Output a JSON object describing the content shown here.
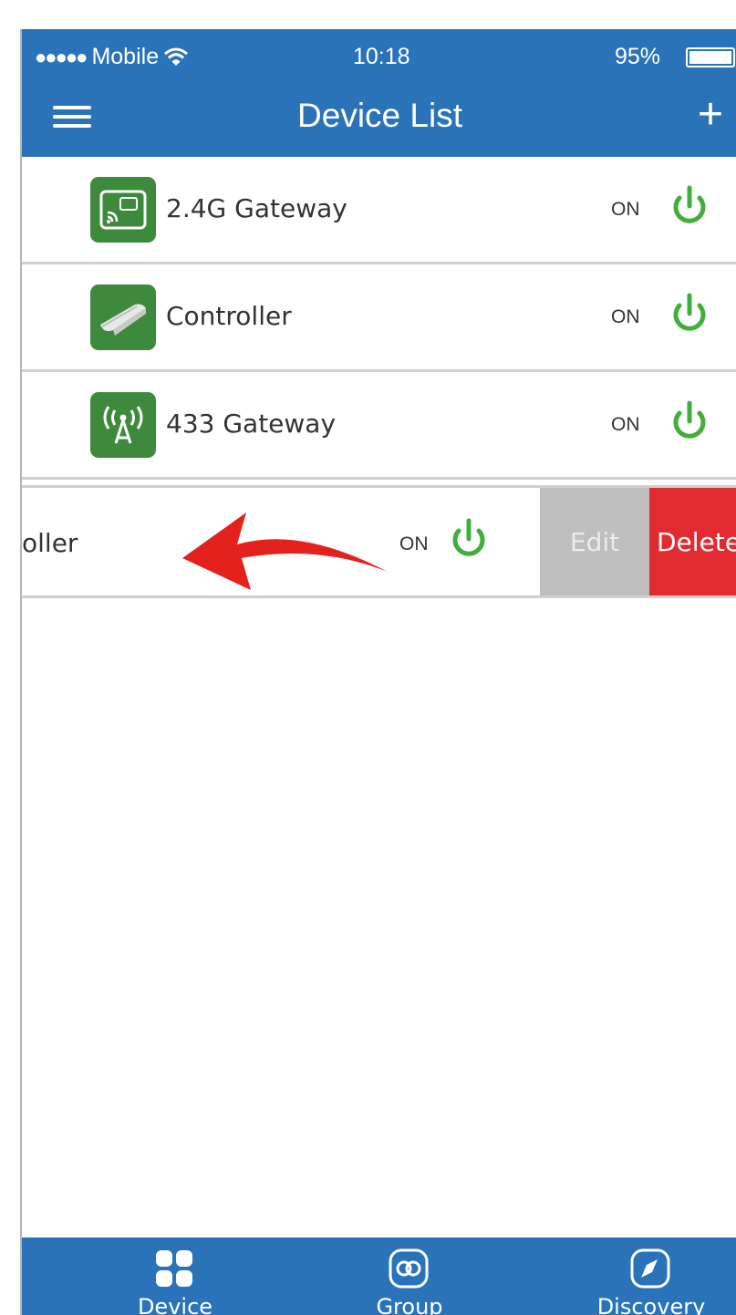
{
  "status_bar": {
    "carrier": "Mobile",
    "time": "10:18",
    "battery": "95%"
  },
  "header": {
    "title": "Device List",
    "add_label": "+"
  },
  "devices": [
    {
      "name": "2.4G Gateway",
      "state": "ON",
      "icon": "gateway-24g-icon"
    },
    {
      "name": "Controller",
      "state": "ON",
      "icon": "controller-icon"
    },
    {
      "name": "433 Gateway",
      "state": "ON",
      "icon": "antenna-433-icon"
    }
  ],
  "swiped_row": {
    "name": "oller",
    "state": "ON",
    "edit_label": "Edit",
    "delete_label": "Delete"
  },
  "tabbar": {
    "tabs": [
      {
        "label": "Device",
        "icon": "grid-icon"
      },
      {
        "label": "Group",
        "icon": "group-icon"
      },
      {
        "label": "Discovery",
        "icon": "compass-icon"
      }
    ]
  },
  "colors": {
    "primary": "#2a73b9",
    "device_icon_bg": "#3e8a3c",
    "power_green": "#3fae3a",
    "delete_red": "#e12b31",
    "edit_gray": "#bfbfbf",
    "arrow_red": "#e3221e"
  }
}
